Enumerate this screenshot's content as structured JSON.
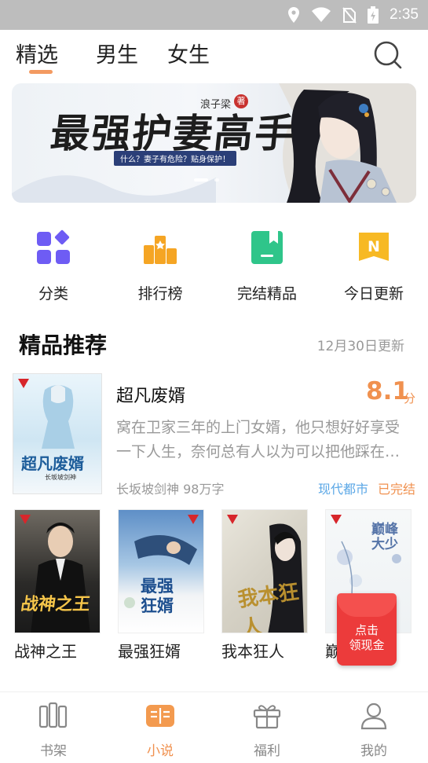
{
  "status_bar": {
    "time": "2:35",
    "icons": [
      "location-icon",
      "wifi-icon",
      "no-sim-icon",
      "battery-icon"
    ]
  },
  "top_tabs": [
    {
      "label": "精选",
      "active": true
    },
    {
      "label": "男生",
      "active": false
    },
    {
      "label": "女生",
      "active": false
    }
  ],
  "banner": {
    "title": "最强护妻高手",
    "author": "浪子梁",
    "author_badge": "著",
    "tagline": "什么？妻子有危险？贴身保护！"
  },
  "shortcuts": [
    {
      "label": "分类",
      "icon": "category-icon"
    },
    {
      "label": "排行榜",
      "icon": "ranking-icon"
    },
    {
      "label": "完结精品",
      "icon": "completed-book-icon"
    },
    {
      "label": "今日更新",
      "icon": "update-icon"
    }
  ],
  "section": {
    "title": "精品推荐",
    "date": "12月30日更新"
  },
  "featured": {
    "title": "超凡废婿",
    "cover_title": "超凡废婿",
    "cover_author": "长坂坡剑神",
    "score": "8.1",
    "score_unit": "分",
    "description": "窝在卫家三年的上门女婿，他只想好好享受一下人生，奈何总有人以为可以把他踩在脚下",
    "meta": "长坂坡剑神 98万字",
    "tags": [
      "现代都市",
      "已完结"
    ]
  },
  "books": [
    {
      "name": "战神之王",
      "cover_text": "战神之王"
    },
    {
      "name": "最强狂婿",
      "cover_text": "最强狂婿"
    },
    {
      "name": "我本狂人",
      "cover_text": "我本狂人"
    },
    {
      "name": "巅",
      "cover_text": "巅峰大少"
    }
  ],
  "red_packet": {
    "line1": "点击",
    "line2": "领现金"
  },
  "bottom_nav": [
    {
      "label": "书架",
      "icon": "bookshelf-icon",
      "active": false
    },
    {
      "label": "小说",
      "icon": "novel-icon",
      "active": true
    },
    {
      "label": "福利",
      "icon": "gift-icon",
      "active": false
    },
    {
      "label": "我的",
      "icon": "profile-icon",
      "active": false
    }
  ],
  "colors": {
    "accent": "#f0914f",
    "tag_blue": "#5aa7e6",
    "red_packet": "#ec3b3b"
  }
}
